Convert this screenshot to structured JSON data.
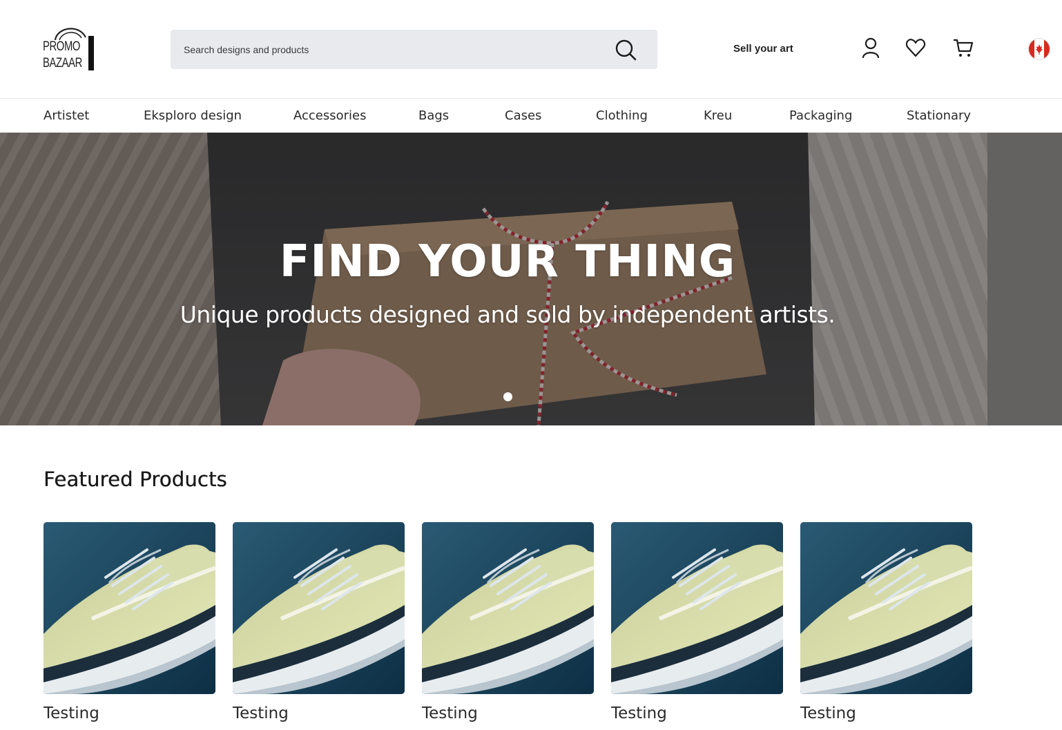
{
  "brand": {
    "logo_line1": "PROMO",
    "logo_line2": "BAZAAR"
  },
  "search": {
    "placeholder": "Search designs and products",
    "icon": "search-icon"
  },
  "header": {
    "sell_label": "Sell your art",
    "icons": [
      "user-icon",
      "heart-icon",
      "cart-icon",
      "canada-flag-icon"
    ]
  },
  "nav": {
    "items": [
      {
        "label": "Artistet"
      },
      {
        "label": "Eksploro design"
      },
      {
        "label": "Accessories"
      },
      {
        "label": "Bags"
      },
      {
        "label": "Cases"
      },
      {
        "label": "Clothing"
      },
      {
        "label": "Kreu"
      },
      {
        "label": "Packaging"
      },
      {
        "label": "Stationary"
      }
    ]
  },
  "hero": {
    "title": "FIND YOUR THING",
    "subtitle": "Unique products designed and sold by independent artists.",
    "slides": 1,
    "active_slide": 1
  },
  "featured": {
    "title": "Featured Products",
    "products": [
      {
        "name": "Testing"
      },
      {
        "name": "Testing"
      },
      {
        "name": "Testing"
      },
      {
        "name": "Testing"
      },
      {
        "name": "Testing"
      }
    ]
  },
  "colors": {
    "search_bg": "#e9eaee",
    "text": "#1a1a1a",
    "product_bg": "#1e4a61",
    "flag_red": "#d52b1e"
  }
}
